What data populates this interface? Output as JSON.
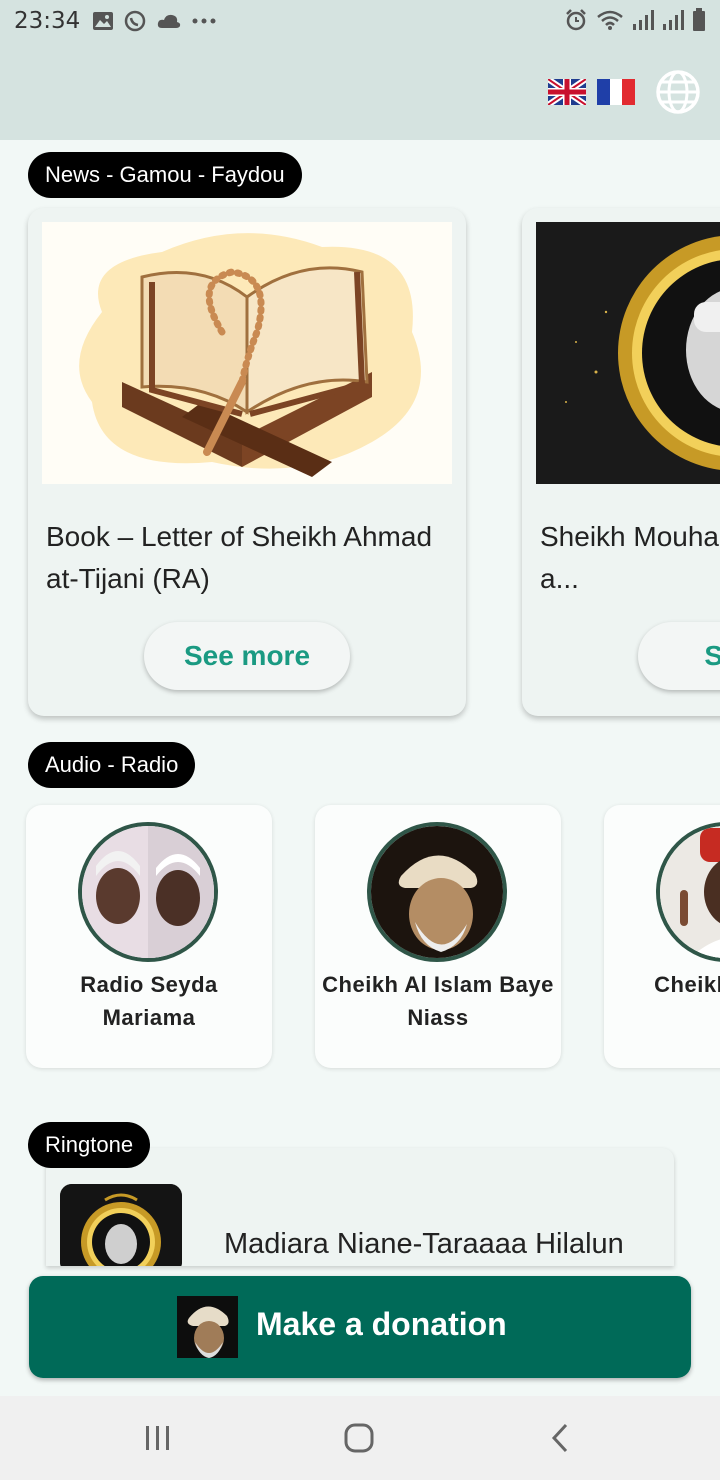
{
  "status_bar": {
    "time": "23:34",
    "left_icons": [
      "gallery-icon",
      "whatsapp-icon",
      "cloud-icon",
      "more-dots-icon"
    ],
    "right_icons": [
      "alarm-icon",
      "wifi-icon",
      "signal-icon",
      "signal-icon",
      "battery-icon"
    ]
  },
  "header": {
    "language_flags": [
      "uk-flag",
      "france-flag"
    ],
    "globe_icon": "globe-icon"
  },
  "sections": {
    "news": {
      "label": "News - Gamou - Faydou",
      "cards": [
        {
          "title": "Book – Letter of Sheikh Ahmad at-Tijani (RA)",
          "button": "See more",
          "image": "quran-on-stand-with-rosary"
        },
        {
          "title": "Sheikh Mouha... Niass, known a...",
          "button": "See...",
          "image": "sheikh-portrait-gold-frame"
        }
      ]
    },
    "audio": {
      "label": "Audio - Radio",
      "items": [
        {
          "name": "Radio Seyda Mariama",
          "avatar": "two-people-photo"
        },
        {
          "name": "Cheikh Al Islam Baye Niass",
          "avatar": "sheikh-sketch-portrait"
        },
        {
          "name": "Cheikh... Di...",
          "avatar": "sheikh-red-cap-photo"
        }
      ]
    },
    "ringtone": {
      "label": "Ringtone",
      "items": [
        {
          "title": "Madiara Niane-Taraaaa Hilalun",
          "thumbnail": "sheikh-gold-frame-thumb"
        }
      ]
    }
  },
  "donate": {
    "label": "Make a donation",
    "thumbnail": "sheikh-portrait-thumb"
  },
  "nav_bar": {
    "buttons": [
      "recent-apps-icon",
      "home-icon",
      "back-icon"
    ]
  },
  "colors": {
    "accent_green": "#006a58",
    "see_more_text": "#1a9a82",
    "chip_bg": "#000000",
    "header_bg": "#d5e3e0"
  }
}
